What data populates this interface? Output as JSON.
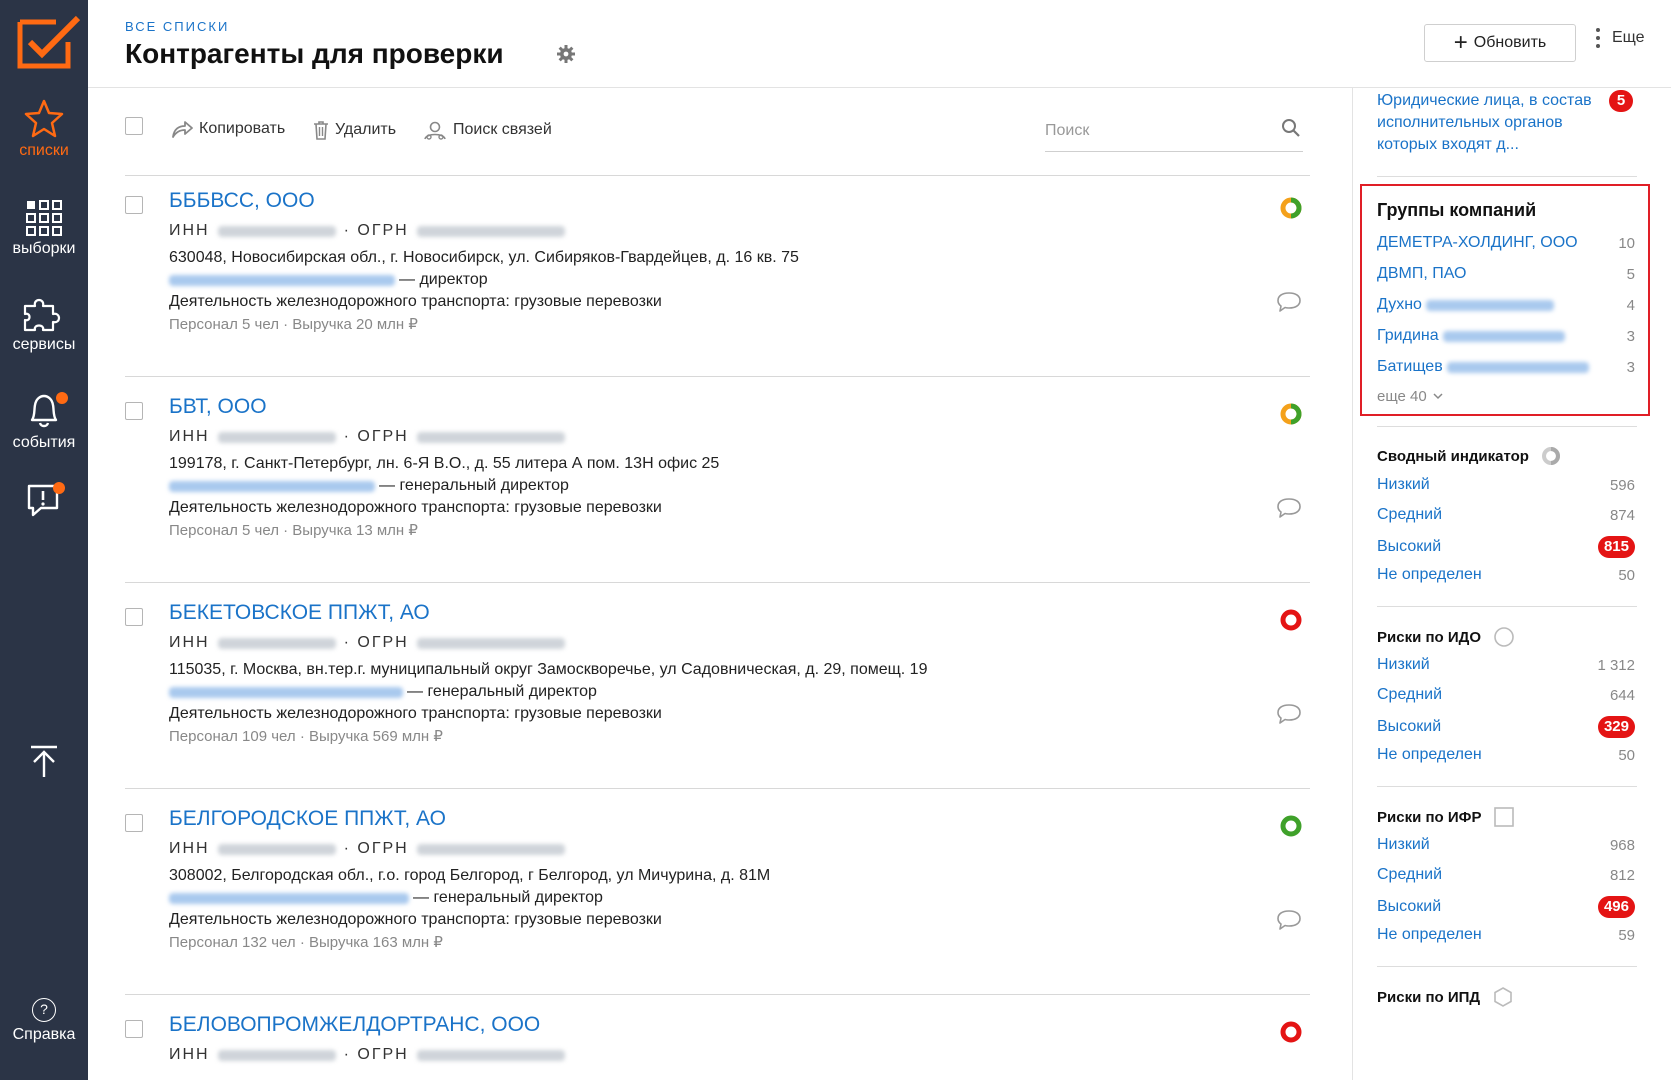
{
  "sidebar": {
    "items": [
      {
        "label": "списки",
        "icon": "star-icon"
      },
      {
        "label": "выборки",
        "icon": "grid-icon"
      },
      {
        "label": "сервисы",
        "icon": "puzzle-icon"
      },
      {
        "label": "события",
        "icon": "bell-icon"
      },
      {
        "label": "",
        "icon": "alert-message-icon"
      }
    ],
    "help_label": "Справка",
    "help_symbol": "?"
  },
  "header": {
    "breadcrumb": "ВСЕ СПИСКИ",
    "title": "Контрагенты для проверки",
    "refresh_label": "Обновить",
    "more_label": "Еще"
  },
  "toolbar": {
    "copy_label": "Копировать",
    "delete_label": "Удалить",
    "links_label": "Поиск связей",
    "search_placeholder": "Поиск"
  },
  "labels": {
    "inn": "ИНН",
    "ogrn": "ОГРН",
    "sep": "·"
  },
  "companies": [
    {
      "name": "БББВСС, ООО",
      "address": "630048, Новосибирская обл., г. Новосибирск, ул. Сибиряков-Гвардейцев, д. 16 кв. 75",
      "role": "— директор",
      "activity": "Деятельность железнодорожного транспорта: грузовые перевозки",
      "staff": "Персонал 5 чел",
      "revenue": "Выручка 20 млн ₽",
      "indicator": "mixed"
    },
    {
      "name": "БВТ, ООО",
      "address": "199178, г. Санкт-Петербург, лн. 6-Я В.О., д. 55 литера А пом. 13Н офис 25",
      "role": "— генеральный директор",
      "activity": "Деятельность железнодорожного транспорта: грузовые перевозки",
      "staff": "Персонал 5 чел",
      "revenue": "Выручка 13 млн ₽",
      "indicator": "mixed"
    },
    {
      "name": "БЕКЕТОВСКОЕ ППЖТ, АО",
      "address": "115035, г. Москва, вн.тер.г. муниципальный округ Замоскворечье, ул Садовническая, д. 29, помещ. 19",
      "role": "— генеральный директор",
      "activity": "Деятельность железнодорожного транспорта: грузовые перевозки",
      "staff": "Персонал 109 чел",
      "revenue": "Выручка 569 млн ₽",
      "indicator": "high"
    },
    {
      "name": "БЕЛГОРОДСКОЕ ППЖТ, АО",
      "address": "308002, Белгородская обл., г.о. город Белгород, г Белгород, ул Мичурина, д. 81М",
      "role": "— генеральный директор",
      "activity": "Деятельность железнодорожного транспорта: грузовые перевозки",
      "staff": "Персонал 132 чел",
      "revenue": "Выручка 163 млн ₽",
      "indicator": "low"
    },
    {
      "name": "БЕЛОВОПРОМЖЕЛДОРТРАНС, ООО",
      "address": "",
      "role": "",
      "activity": "",
      "staff": "",
      "revenue": "",
      "indicator": "high"
    }
  ],
  "right_panel": {
    "top_link": {
      "text": "Юридические лица, в состав исполнительных органов которых входят д...",
      "badge": "5"
    },
    "groups": {
      "title": "Группы компаний",
      "items": [
        {
          "name": "ДЕМЕТРА-ХОЛДИНГ, ООО",
          "count": "10"
        },
        {
          "name": "ДВМП, ПАО",
          "count": "5"
        },
        {
          "name": "Духно",
          "count": "4"
        },
        {
          "name": "Гридина",
          "count": "3"
        },
        {
          "name": "Батищев",
          "count": "3"
        }
      ],
      "more": "еще 40"
    },
    "sections": [
      {
        "title": "Сводный индикатор",
        "rows": [
          {
            "label": "Низкий",
            "count": "596"
          },
          {
            "label": "Средний",
            "count": "874"
          },
          {
            "label": "Высокий",
            "count": "815",
            "badge": true
          },
          {
            "label": "Не определен",
            "count": "50"
          }
        ]
      },
      {
        "title": "Риски по ИДО",
        "rows": [
          {
            "label": "Низкий",
            "count": "1 312"
          },
          {
            "label": "Средний",
            "count": "644"
          },
          {
            "label": "Высокий",
            "count": "329",
            "badge": true
          },
          {
            "label": "Не определен",
            "count": "50"
          }
        ]
      },
      {
        "title": "Риски по ИФР",
        "rows": [
          {
            "label": "Низкий",
            "count": "968"
          },
          {
            "label": "Средний",
            "count": "812"
          },
          {
            "label": "Высокий",
            "count": "496",
            "badge": true
          },
          {
            "label": "Не определен",
            "count": "59"
          }
        ]
      },
      {
        "title": "Риски по ИПД",
        "rows": []
      }
    ]
  },
  "colors": {
    "accent": "#ff6a13",
    "link": "#1a73c8",
    "sidebar_bg": "#2b3446",
    "danger": "#e41414",
    "green": "#3fa12a"
  }
}
